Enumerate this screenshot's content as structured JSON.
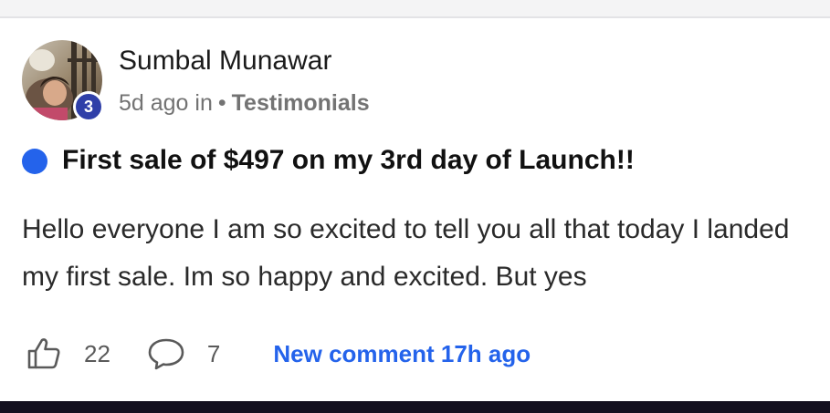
{
  "post": {
    "author": {
      "name": "Sumbal Munawar",
      "level": "3"
    },
    "meta": {
      "time": "5d ago in",
      "separator": "•",
      "category": "Testimonials"
    },
    "title": "First sale of $497 on my 3rd day of Launch!!",
    "body": "Hello everyone I am so excited to tell you all that today I landed my first sale. Im so happy and excited. But yes",
    "stats": {
      "likes": "22",
      "comments": "7",
      "new_comment": "New comment 17h ago"
    }
  },
  "icons": {
    "like": "thumbs-up-icon",
    "comment": "comment-bubble-icon"
  },
  "colors": {
    "accent": "#2463eb",
    "level_badge": "#2f3fa8",
    "muted_text": "#737373"
  }
}
